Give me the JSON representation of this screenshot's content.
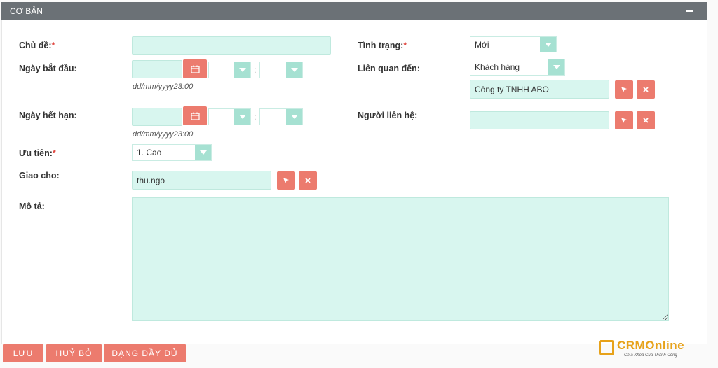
{
  "panel": {
    "title": "CƠ BẢN"
  },
  "form": {
    "subject_label": "Chủ đề:",
    "status_label": "Tình trạng:",
    "status_value": "Mới",
    "start_label": "Ngày bắt đầu:",
    "start_hint": "dd/mm/yyyy23:00",
    "related_label": "Liên quan đến:",
    "related_type": "Khách hàng",
    "related_value": "Công ty TNHH ABO",
    "due_label": "Ngày hết hạn:",
    "due_hint": "dd/mm/yyyy23:00",
    "contact_label": "Người liên hệ:",
    "priority_label": "Ưu tiên:",
    "priority_value": "1. Cao",
    "assign_label": "Giao cho:",
    "assign_value": "thu.ngo",
    "desc_label": "Mô tả:",
    "required_mark": "*",
    "time_sep": ":"
  },
  "footer": {
    "save": "LƯU",
    "cancel": "HUỶ BỎ",
    "full": "DẠNG ĐẦY ĐỦ"
  },
  "logo": {
    "name": "CRMOnline",
    "tagline": "Chìa Khoá Của Thành Công"
  },
  "colors": {
    "accent": "#ec7b6e",
    "field": "#d8f6ef",
    "arrow": "#a6e1d2",
    "header": "#6b7176"
  }
}
